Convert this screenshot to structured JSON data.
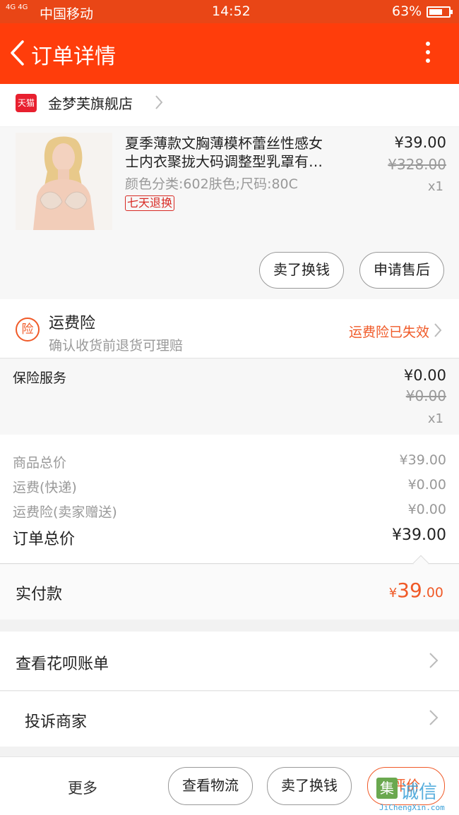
{
  "status_bar": {
    "signal": "4G 4G",
    "carrier": "中国移动",
    "time": "14:52",
    "battery": "63%"
  },
  "nav": {
    "title": "订单详情"
  },
  "shop": {
    "badge": "天猫",
    "name": "金梦芙旗舰店"
  },
  "product": {
    "title_line1": "夏季薄款文胸薄模杯蕾丝性感女",
    "title_line2": "士内衣聚拢大码调整型乳罩有…",
    "spec": "颜色分类:602肤色;尺码:80C",
    "badge": "七天退换",
    "price": "¥39.00",
    "original_price": "¥328.00",
    "quantity": "x1",
    "btn_sell": "卖了换钱",
    "btn_aftersale": "申请售后"
  },
  "insurance": {
    "icon_text": "险",
    "label": "运费险",
    "sub": "确认收货前退货可理赔",
    "status": "运费险已失效"
  },
  "service": {
    "label": "保险服务",
    "price": "¥0.00",
    "original_price": "¥0.00",
    "quantity": "x1"
  },
  "summary": {
    "rows": [
      {
        "label": "商品总价",
        "value": "¥39.00"
      },
      {
        "label": "运费(快递)",
        "value": "¥0.00"
      },
      {
        "label": "运费险(卖家赠送)",
        "value": "¥0.00"
      }
    ],
    "total_label": "订单总价",
    "total_value": "¥39.00"
  },
  "paid": {
    "label": "实付款",
    "symbol": "¥",
    "integer": "39",
    "decimal": ".00"
  },
  "menu": {
    "huabei": "查看花呗账单",
    "complain": "投诉商家"
  },
  "bottom": {
    "more": "更多",
    "logistics": "查看物流",
    "sell": "卖了换钱",
    "rate": "评价"
  },
  "watermark": {
    "mark": "集",
    "text": "诚信",
    "url": "JiChengXin.com"
  },
  "colors": {
    "brand": "#ff3d0b",
    "accent": "#f05a28",
    "tmall": "#e8202f"
  }
}
